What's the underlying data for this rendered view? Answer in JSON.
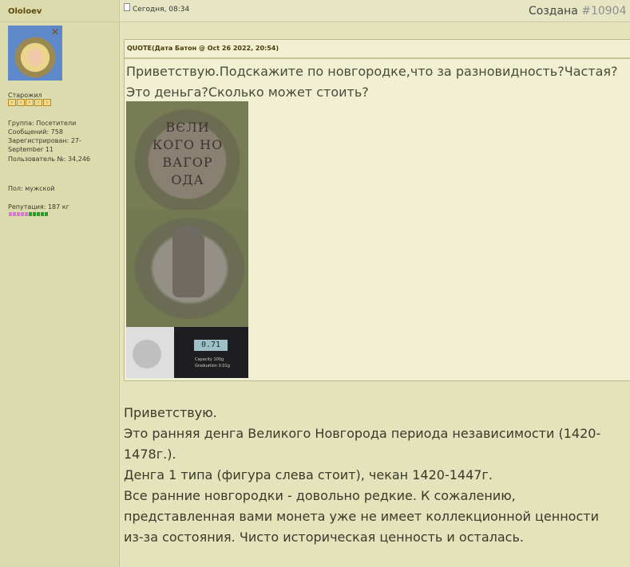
{
  "author": {
    "name": "Ololoev",
    "rank": "Старожил",
    "group": "Группа: Посетители",
    "messages": "Сообщений: 758",
    "registered": "Зарегистрирован: 27-September 11",
    "user_id": "Пользователь №: 34,246",
    "gender": "Пол: мужской",
    "reputation": "Репутация: 187 кг"
  },
  "post": {
    "date": "Сегодня, 08:34",
    "created_label": "Создана",
    "post_number": "#10904"
  },
  "quote": {
    "header": "QUOTE(Дата Батон @ Oct 26 2022, 20:54)",
    "lines": [
      "Приветствую.Подскажите по новгородке,что за разновидность?Частая?",
      "Это деньга?Сколько может стоить?"
    ],
    "coin_legend": [
      "ВЄЛИ",
      "КОГО НО",
      "ВАГОР",
      "ОДА"
    ],
    "scale": {
      "display": "0.71",
      "capacity": "Capacity 100g",
      "graduation": "Graduation 0.01g"
    }
  },
  "reply": {
    "lines": [
      "Приветствую.",
      "Это ранняя денга Великого Новгорода периода независимости (1420-",
      "1478г.).",
      "Денга 1 типа (фигура слева стоит), чекан 1420-1447г.",
      "Все ранние новгородки - довольно редкие. К сожалению,",
      "представленная вами монета уже не имеет коллекционной ценности",
      "из-за состояния. Чисто историческая ценность и осталась."
    ]
  },
  "colors": {
    "background": "#e4e3bc",
    "author_name": "#5d4a0c",
    "post_number": "#8e8e8e"
  }
}
